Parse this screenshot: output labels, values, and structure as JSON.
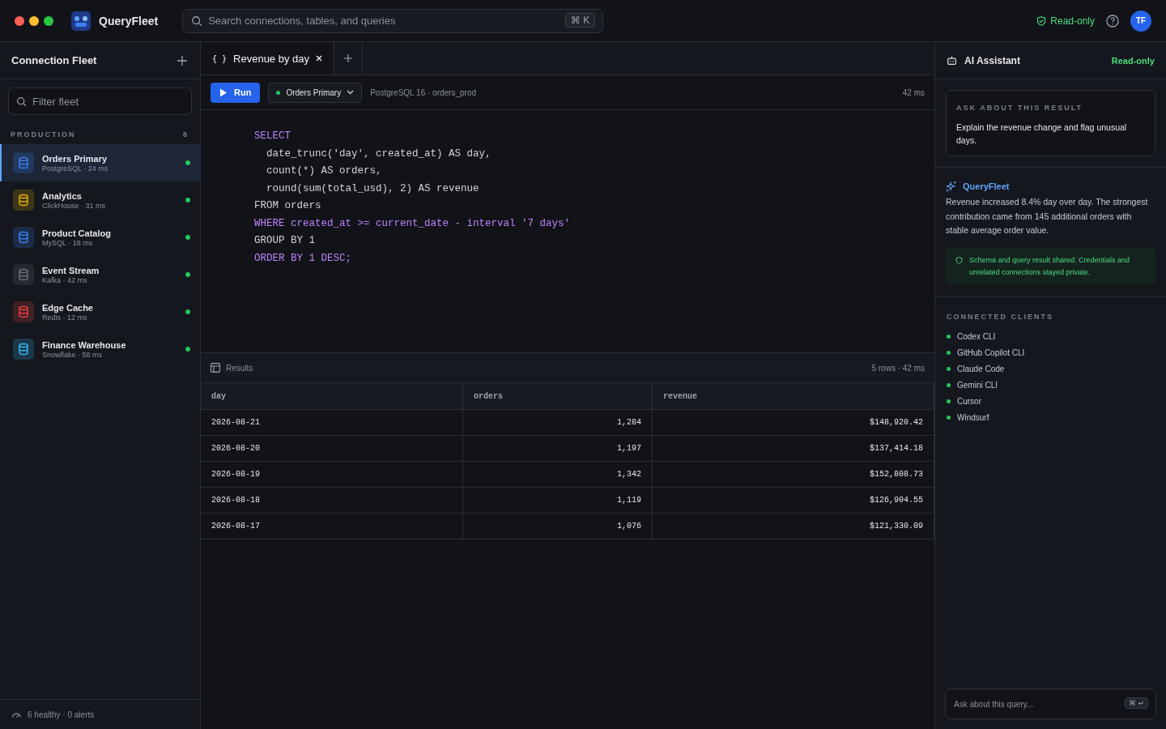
{
  "app": {
    "name": "QueryFleet"
  },
  "search": {
    "placeholder": "Search connections, tables, and queries",
    "shortcut": "⌘ K"
  },
  "header": {
    "mode": "Read-only",
    "avatar": "TF"
  },
  "sidebar": {
    "title": "Connection Fleet",
    "filter": {
      "placeholder": "Filter fleet"
    },
    "group": {
      "label": "PRODUCTION",
      "count": "6"
    },
    "connections": [
      {
        "name": "Orders Primary",
        "detail": "PostgreSQL · 24 ms",
        "color": "#3b82f6",
        "selected": true,
        "healthy": true
      },
      {
        "name": "Analytics",
        "detail": "ClickHouse · 31 ms",
        "color": "#eab308",
        "selected": false,
        "healthy": true
      },
      {
        "name": "Product Catalog",
        "detail": "MySQL · 18 ms",
        "color": "#3b82f6",
        "selected": false,
        "healthy": true
      },
      {
        "name": "Event Stream",
        "detail": "Kafka · 42 ms",
        "color": "#6b7280",
        "selected": false,
        "healthy": true
      },
      {
        "name": "Edge Cache",
        "detail": "Redis · 12 ms",
        "color": "#ef4444",
        "selected": false,
        "healthy": true
      },
      {
        "name": "Finance Warehouse",
        "detail": "Snowflake · 58 ms",
        "color": "#38bdf8",
        "selected": false,
        "healthy": true
      }
    ],
    "footer": "6 healthy · 0 alerts"
  },
  "tabs": [
    {
      "icon": "{ }",
      "label": "Revenue by day",
      "selected": true
    }
  ],
  "toolbar": {
    "run": "Run",
    "connection": "Orders Primary",
    "info": "PostgreSQL 16 · orders_prod",
    "timing": "42 ms"
  },
  "editor": {
    "lines": [
      {
        "kind": "keyword",
        "text": "SELECT"
      },
      {
        "kind": "plain",
        "text": "  date_trunc('day', created_at) AS day,"
      },
      {
        "kind": "plain",
        "text": "  count(*) AS orders,"
      },
      {
        "kind": "plain",
        "text": "  round(sum(total_usd), 2) AS revenue"
      },
      {
        "kind": "plain",
        "text": "FROM orders"
      },
      {
        "kind": "keyword",
        "text": "WHERE created_at >= current_date - interval '7 days'"
      },
      {
        "kind": "plain",
        "text": "GROUP BY 1"
      },
      {
        "kind": "keyword",
        "text": "ORDER BY 1 DESC;"
      }
    ]
  },
  "results": {
    "title": "Results",
    "summary": "5 rows · 42 ms",
    "columns": [
      "day",
      "orders",
      "revenue"
    ],
    "rows": [
      [
        "2026-08-21",
        "1,284",
        "$148,920.42"
      ],
      [
        "2026-08-20",
        "1,197",
        "$137,414.18"
      ],
      [
        "2026-08-19",
        "1,342",
        "$152,808.73"
      ],
      [
        "2026-08-18",
        "1,119",
        "$126,904.55"
      ],
      [
        "2026-08-17",
        "1,076",
        "$121,330.09"
      ]
    ]
  },
  "assistant": {
    "title": "AI Assistant",
    "mode": "Read-only",
    "prompt_label": "ASK ABOUT THIS RESULT",
    "prompt": "Explain the revenue change and flag unusual days.",
    "reply_author": "QueryFleet",
    "reply": "Revenue increased 8.4% day over day. The strongest contribution came from 145 additional orders with stable average order value.",
    "privacy": "Schema and query result shared. Credentials and unrelated connections stayed private.",
    "clients_label": "CONNECTED CLIENTS",
    "clients": [
      {
        "name": "Codex CLI",
        "connected": true
      },
      {
        "name": "GitHub Copilot CLI",
        "connected": true
      },
      {
        "name": "Claude Code",
        "connected": true
      },
      {
        "name": "Gemini CLI",
        "connected": true
      },
      {
        "name": "Cursor",
        "connected": true
      },
      {
        "name": "Windsurf",
        "connected": true
      }
    ],
    "input": {
      "placeholder": "Ask about this query...",
      "shortcut": "⌘ ↵"
    }
  }
}
